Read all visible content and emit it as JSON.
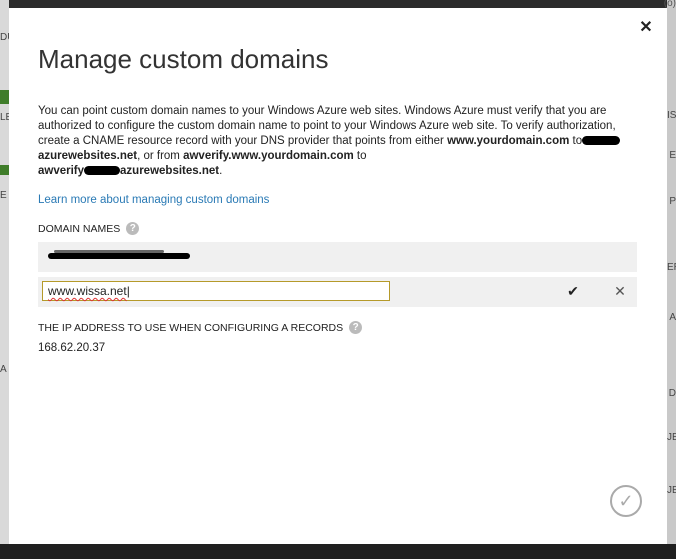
{
  "dialog": {
    "title": "Manage custom domains",
    "close_icon": "close-icon",
    "description": {
      "part1": "You can point custom domain names to your Windows Azure web sites. Windows Azure must verify that you are authorized to configure the custom domain name to point to your Windows Azure web site. To verify authorization, create a CNAME resource record with your DNS provider that points from either ",
      "domain1": "www.yourdomain.com",
      "to1": " to",
      "azure1": "azurewebsites.net",
      "mid": ", or from ",
      "domain2": "awverify.www.yourdomain.com",
      "to2": " to",
      "awverify": "awverify",
      "azure2": "azurewebsites.net",
      "end": "."
    },
    "learn_more": "Learn more about managing custom domains",
    "domain_names_label": "DOMAIN NAMES",
    "new_domain_value": "www.wissa.net",
    "ip_label": "THE IP ADDRESS TO USE WHEN CONFIGURING A RECORDS",
    "ip_value": "168.62.20.37",
    "icons": {
      "help": "help-icon",
      "confirm": "checkmark-icon",
      "cancel": "x-icon",
      "ok": "circle-checkmark-icon"
    }
  },
  "background": {
    "left_fragments": [
      "DU",
      "LE",
      "E",
      "A"
    ],
    "right_fragments": [
      "IS",
      "E",
      "P",
      "ER",
      "A",
      "D",
      "JE",
      "JE"
    ],
    "top_right": "(o)"
  }
}
